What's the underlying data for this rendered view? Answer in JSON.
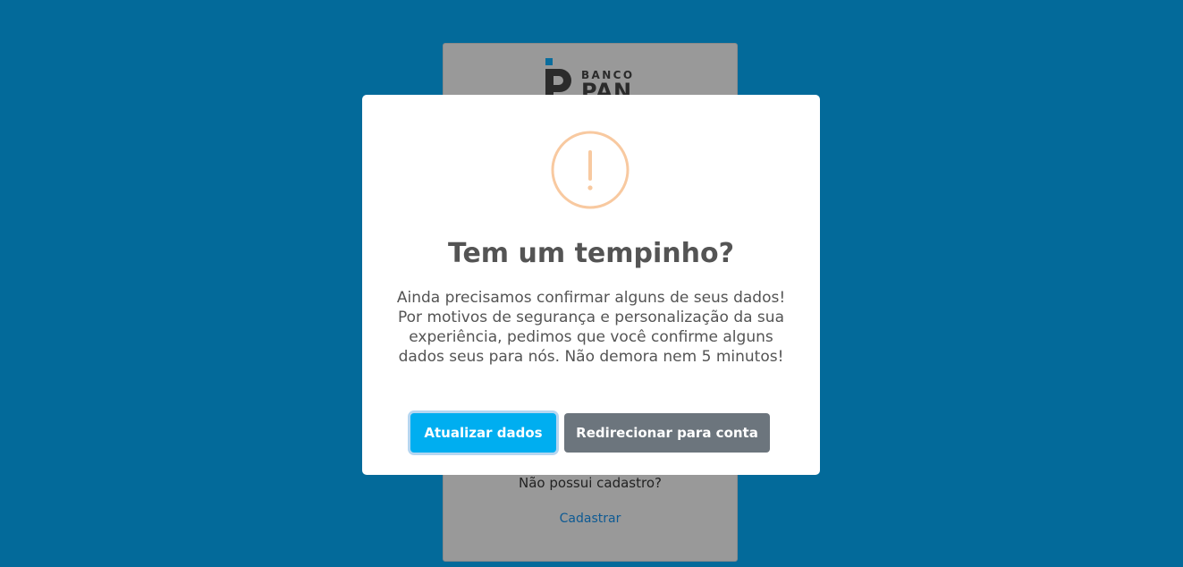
{
  "background": {
    "color": "#036a9a"
  },
  "login_card": {
    "logo": {
      "banco": "BANCO",
      "pan": "PAN"
    },
    "no_account_text": "Não possui cadastro?",
    "register_link": "Cadastrar"
  },
  "modal": {
    "icon": "warning-exclamation-icon",
    "icon_glyph": "!",
    "icon_color": "#f8c9a0",
    "title": "Tem um tempinho?",
    "text": "Ainda precisamos confirmar alguns de seus dados! Por motivos de segurança e personalização da sua experiência, pedimos que você confirme alguns dados seus para nós. Não demora nem 5 minutos!",
    "primary_button": "Atualizar dados",
    "primary_color": "#00aef0",
    "secondary_button": "Redirecionar para conta",
    "secondary_color": "#6c757d"
  }
}
